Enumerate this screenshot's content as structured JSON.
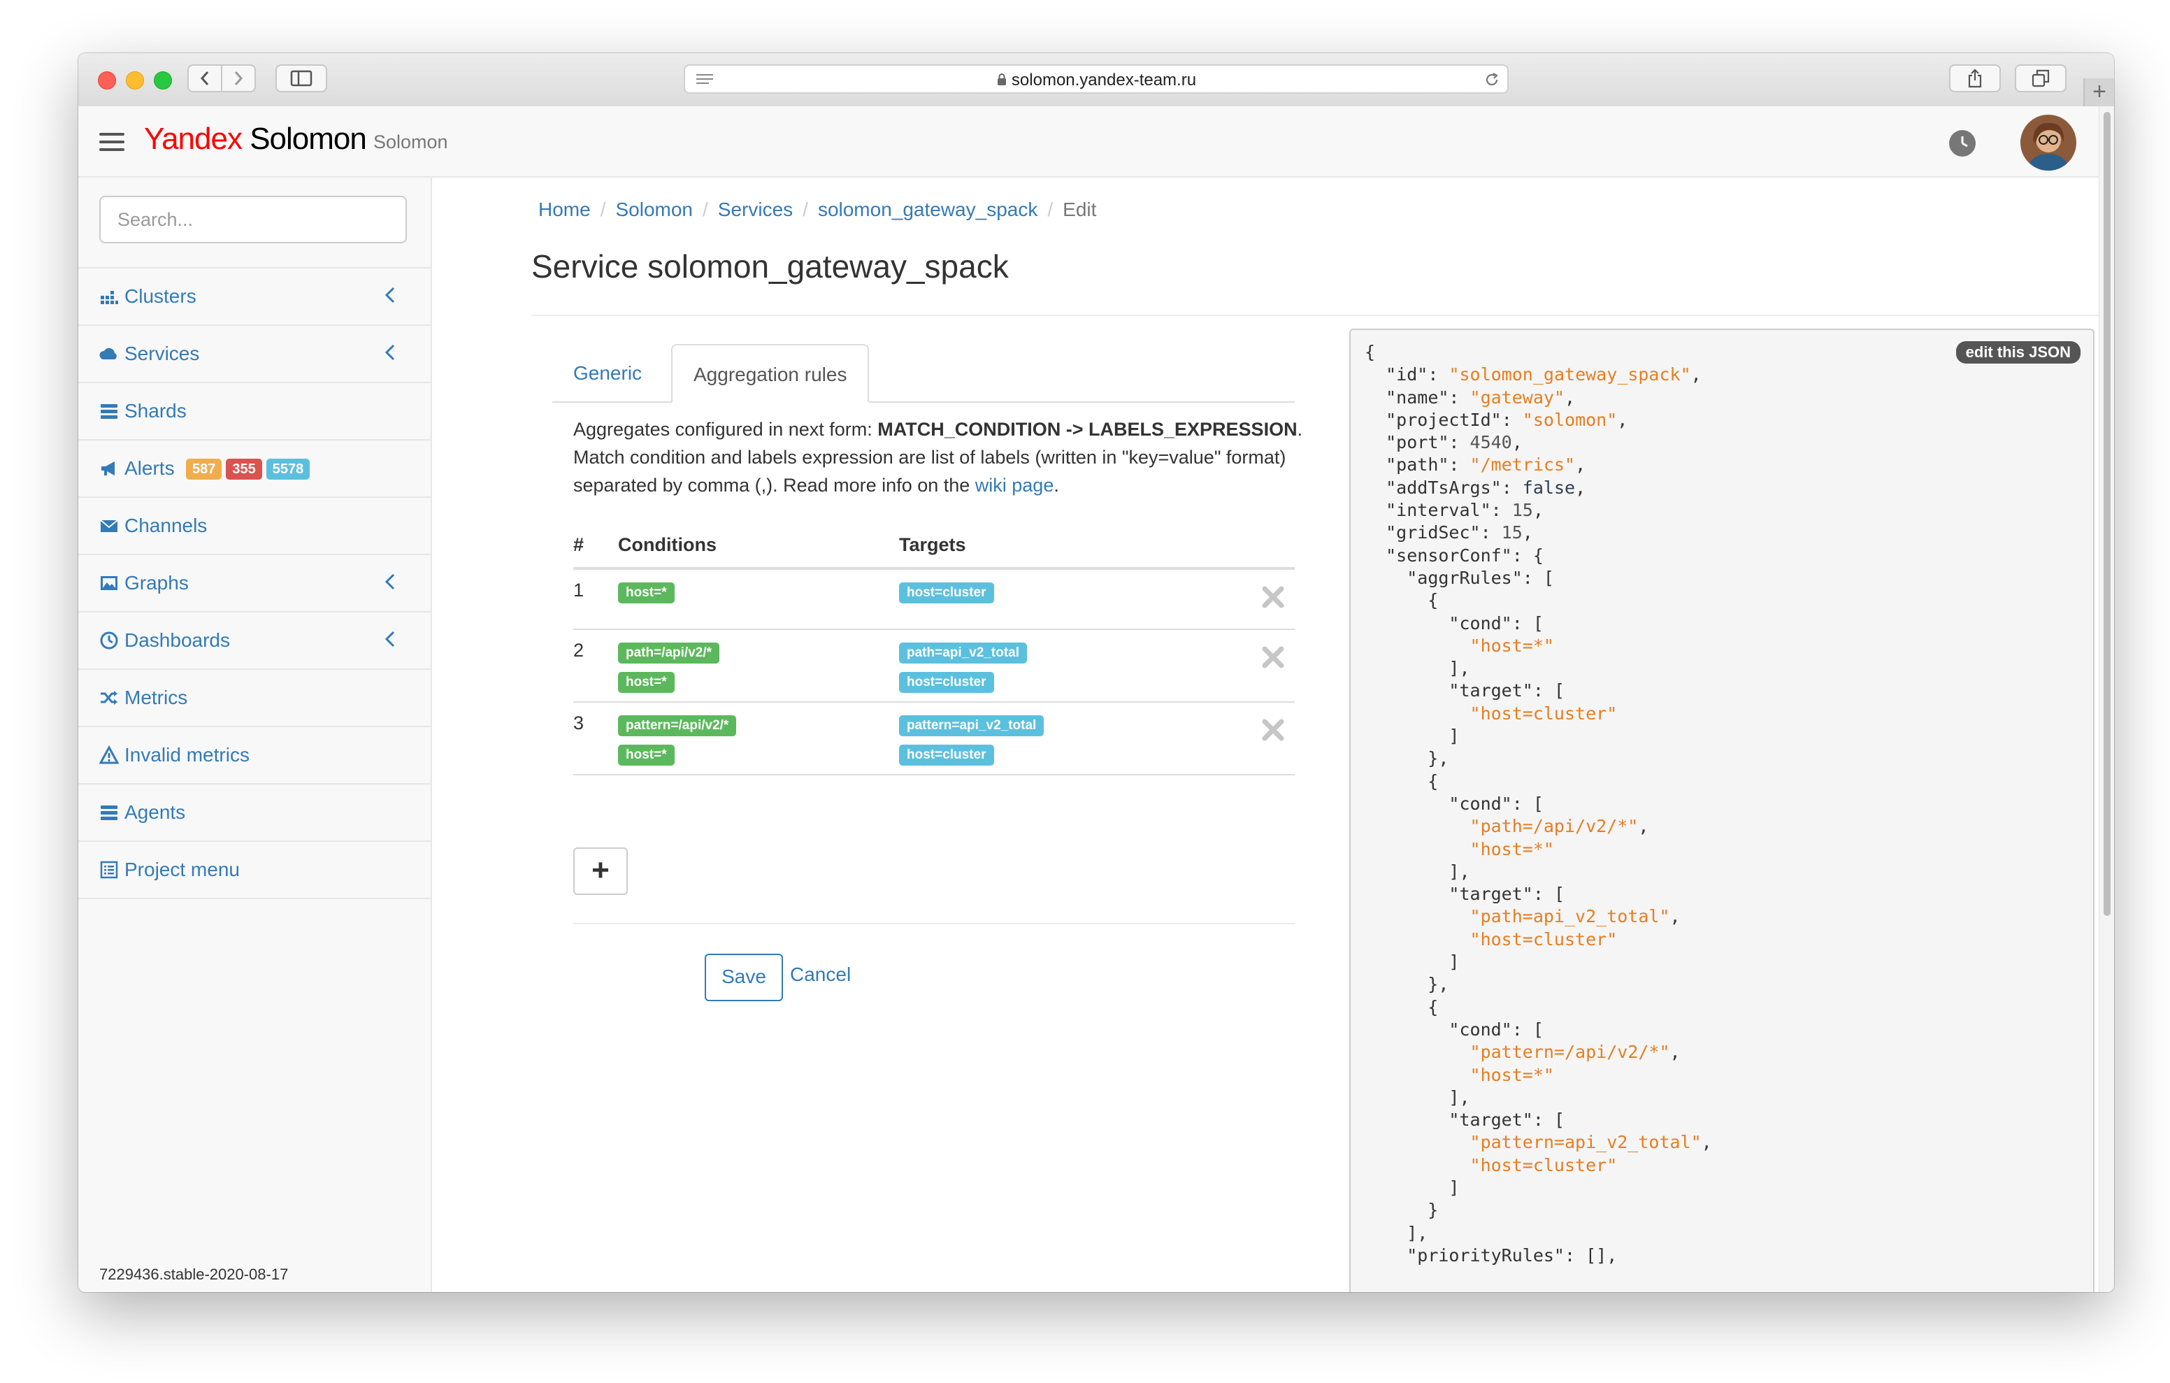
{
  "browser": {
    "url": "solomon.yandex-team.ru"
  },
  "header": {
    "logo_yandex": "Yandex",
    "logo_solomon": "Solomon",
    "brand": "Solomon"
  },
  "sidebar": {
    "search_placeholder": "Search...",
    "items": [
      {
        "label": "Clusters"
      },
      {
        "label": "Services"
      },
      {
        "label": "Shards"
      },
      {
        "label": "Alerts",
        "badges": [
          "587",
          "355",
          "5578"
        ]
      },
      {
        "label": "Channels"
      },
      {
        "label": "Graphs"
      },
      {
        "label": "Dashboards"
      },
      {
        "label": "Metrics"
      },
      {
        "label": "Invalid metrics"
      },
      {
        "label": "Agents"
      },
      {
        "label": "Project menu"
      }
    ],
    "version": "7229436.stable-2020-08-17"
  },
  "breadcrumb": [
    "Home",
    "Solomon",
    "Services",
    "solomon_gateway_spack",
    "Edit"
  ],
  "page_title": "Service solomon_gateway_spack",
  "tabs": [
    "Generic",
    "Aggregation rules"
  ],
  "description": {
    "part1": "Aggregates configured in next form: ",
    "bold1": "MATCH_CONDITION -> LABELS_EXPRESSION",
    "part2": ". Match condition and labels expression are list of labels (written in \"key=value\" format) separated by comma (,). Read more info on the ",
    "link": "wiki page",
    "part3": "."
  },
  "rules_table": {
    "headers": [
      "#",
      "Conditions",
      "Targets"
    ],
    "rows": [
      {
        "num": "1",
        "conditions": [
          "host=*"
        ],
        "targets": [
          "host=cluster"
        ]
      },
      {
        "num": "2",
        "conditions": [
          "path=/api/v2/*",
          "host=*"
        ],
        "targets": [
          "path=api_v2_total",
          "host=cluster"
        ]
      },
      {
        "num": "3",
        "conditions": [
          "pattern=/api/v2/*",
          "host=*"
        ],
        "targets": [
          "pattern=api_v2_total",
          "host=cluster"
        ]
      }
    ]
  },
  "buttons": {
    "add": "+",
    "save": "Save",
    "cancel": "Cancel"
  },
  "json_panel": {
    "edit_label": "edit this JSON",
    "id": "solomon_gateway_spack",
    "name": "gateway",
    "projectId": "solomon",
    "port": "4540",
    "path": "/metrics",
    "addTsArgs": "false",
    "interval": "15",
    "gridSec": "15"
  },
  "colors": {
    "link": "#337ab7",
    "badge_warning": "#f0ad4e",
    "badge_danger": "#d9534f",
    "badge_info": "#5bc0de",
    "label_green": "#5cb85c",
    "label_blue": "#5bc0de",
    "json_string": "#e67e22"
  }
}
